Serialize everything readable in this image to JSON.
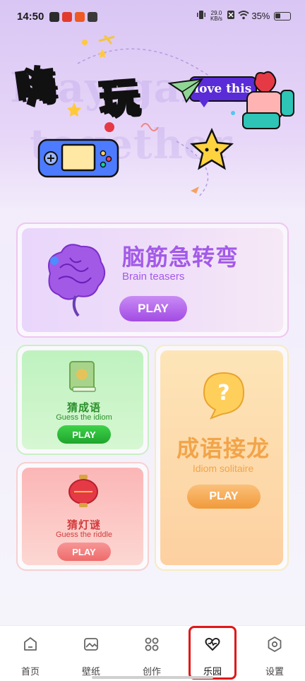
{
  "status_bar": {
    "time": "14:50",
    "network_speed_top": "29.0",
    "network_speed_unit": "KB/s",
    "battery": "35%"
  },
  "hero": {
    "char1": "嗨",
    "char2": "玩",
    "bubble_text": "love this",
    "watermark_line1": "Play game",
    "watermark_line2": "together"
  },
  "cards": {
    "brain": {
      "title": "脑筋急转弯",
      "subtitle": "Brain teasers",
      "play": "PLAY"
    },
    "idiom": {
      "title": "猜成语",
      "subtitle": "Guess the idiom",
      "play": "PLAY"
    },
    "solitaire": {
      "title": "成语接龙",
      "subtitle": "Idiom solitaire",
      "play": "PLAY"
    },
    "riddle": {
      "title": "猜灯谜",
      "subtitle": "Guess the riddle",
      "play": "PLAY"
    }
  },
  "nav": {
    "items": [
      {
        "label": "首页",
        "icon": "home-icon"
      },
      {
        "label": "壁纸",
        "icon": "image-icon"
      },
      {
        "label": "创作",
        "icon": "grid-icon"
      },
      {
        "label": "乐园",
        "icon": "heart-pulse-icon"
      },
      {
        "label": "设置",
        "icon": "settings-icon"
      }
    ],
    "active_index": 3
  },
  "colors": {
    "purple": "#a35ae8",
    "green": "#2dbb3a",
    "orange": "#f2a448",
    "red": "#f27878"
  }
}
